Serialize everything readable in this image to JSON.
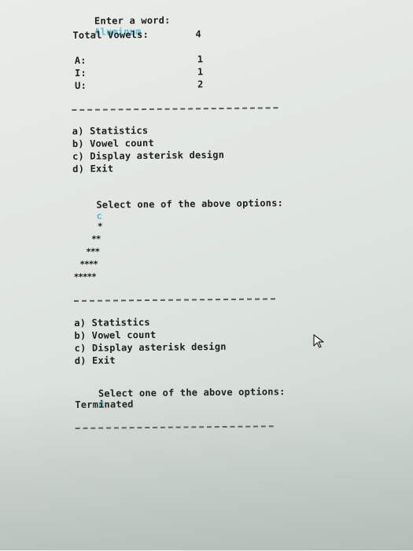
{
  "prompt": {
    "label": "Enter a word:",
    "value": "Aluminum"
  },
  "total": {
    "label": "Total Vowels:",
    "value": "4"
  },
  "vowels": [
    {
      "label": "A:",
      "count": "1"
    },
    {
      "label": "I:",
      "count": "1"
    },
    {
      "label": "U:",
      "count": "2"
    }
  ],
  "menu1": {
    "items": [
      "a) Statistics",
      "b) Vowel count",
      "c) Display asterisk design",
      "d) Exit"
    ],
    "select_label": "Select one of the above options:",
    "select_value": "c"
  },
  "stars": [
    "*",
    "**",
    "***",
    "****",
    "*****"
  ],
  "menu2": {
    "items": [
      "a) Statistics",
      "b) Vowel count",
      "c) Display asterisk design",
      "d) Exit"
    ],
    "select_label": "Select one of the above options:",
    "select_value": "d"
  },
  "terminated": "Terminated",
  "colors": {
    "input": "#5fb7d4",
    "text": "#1c1f1c"
  },
  "icons": {
    "cursor": "mouse-pointer-icon"
  }
}
